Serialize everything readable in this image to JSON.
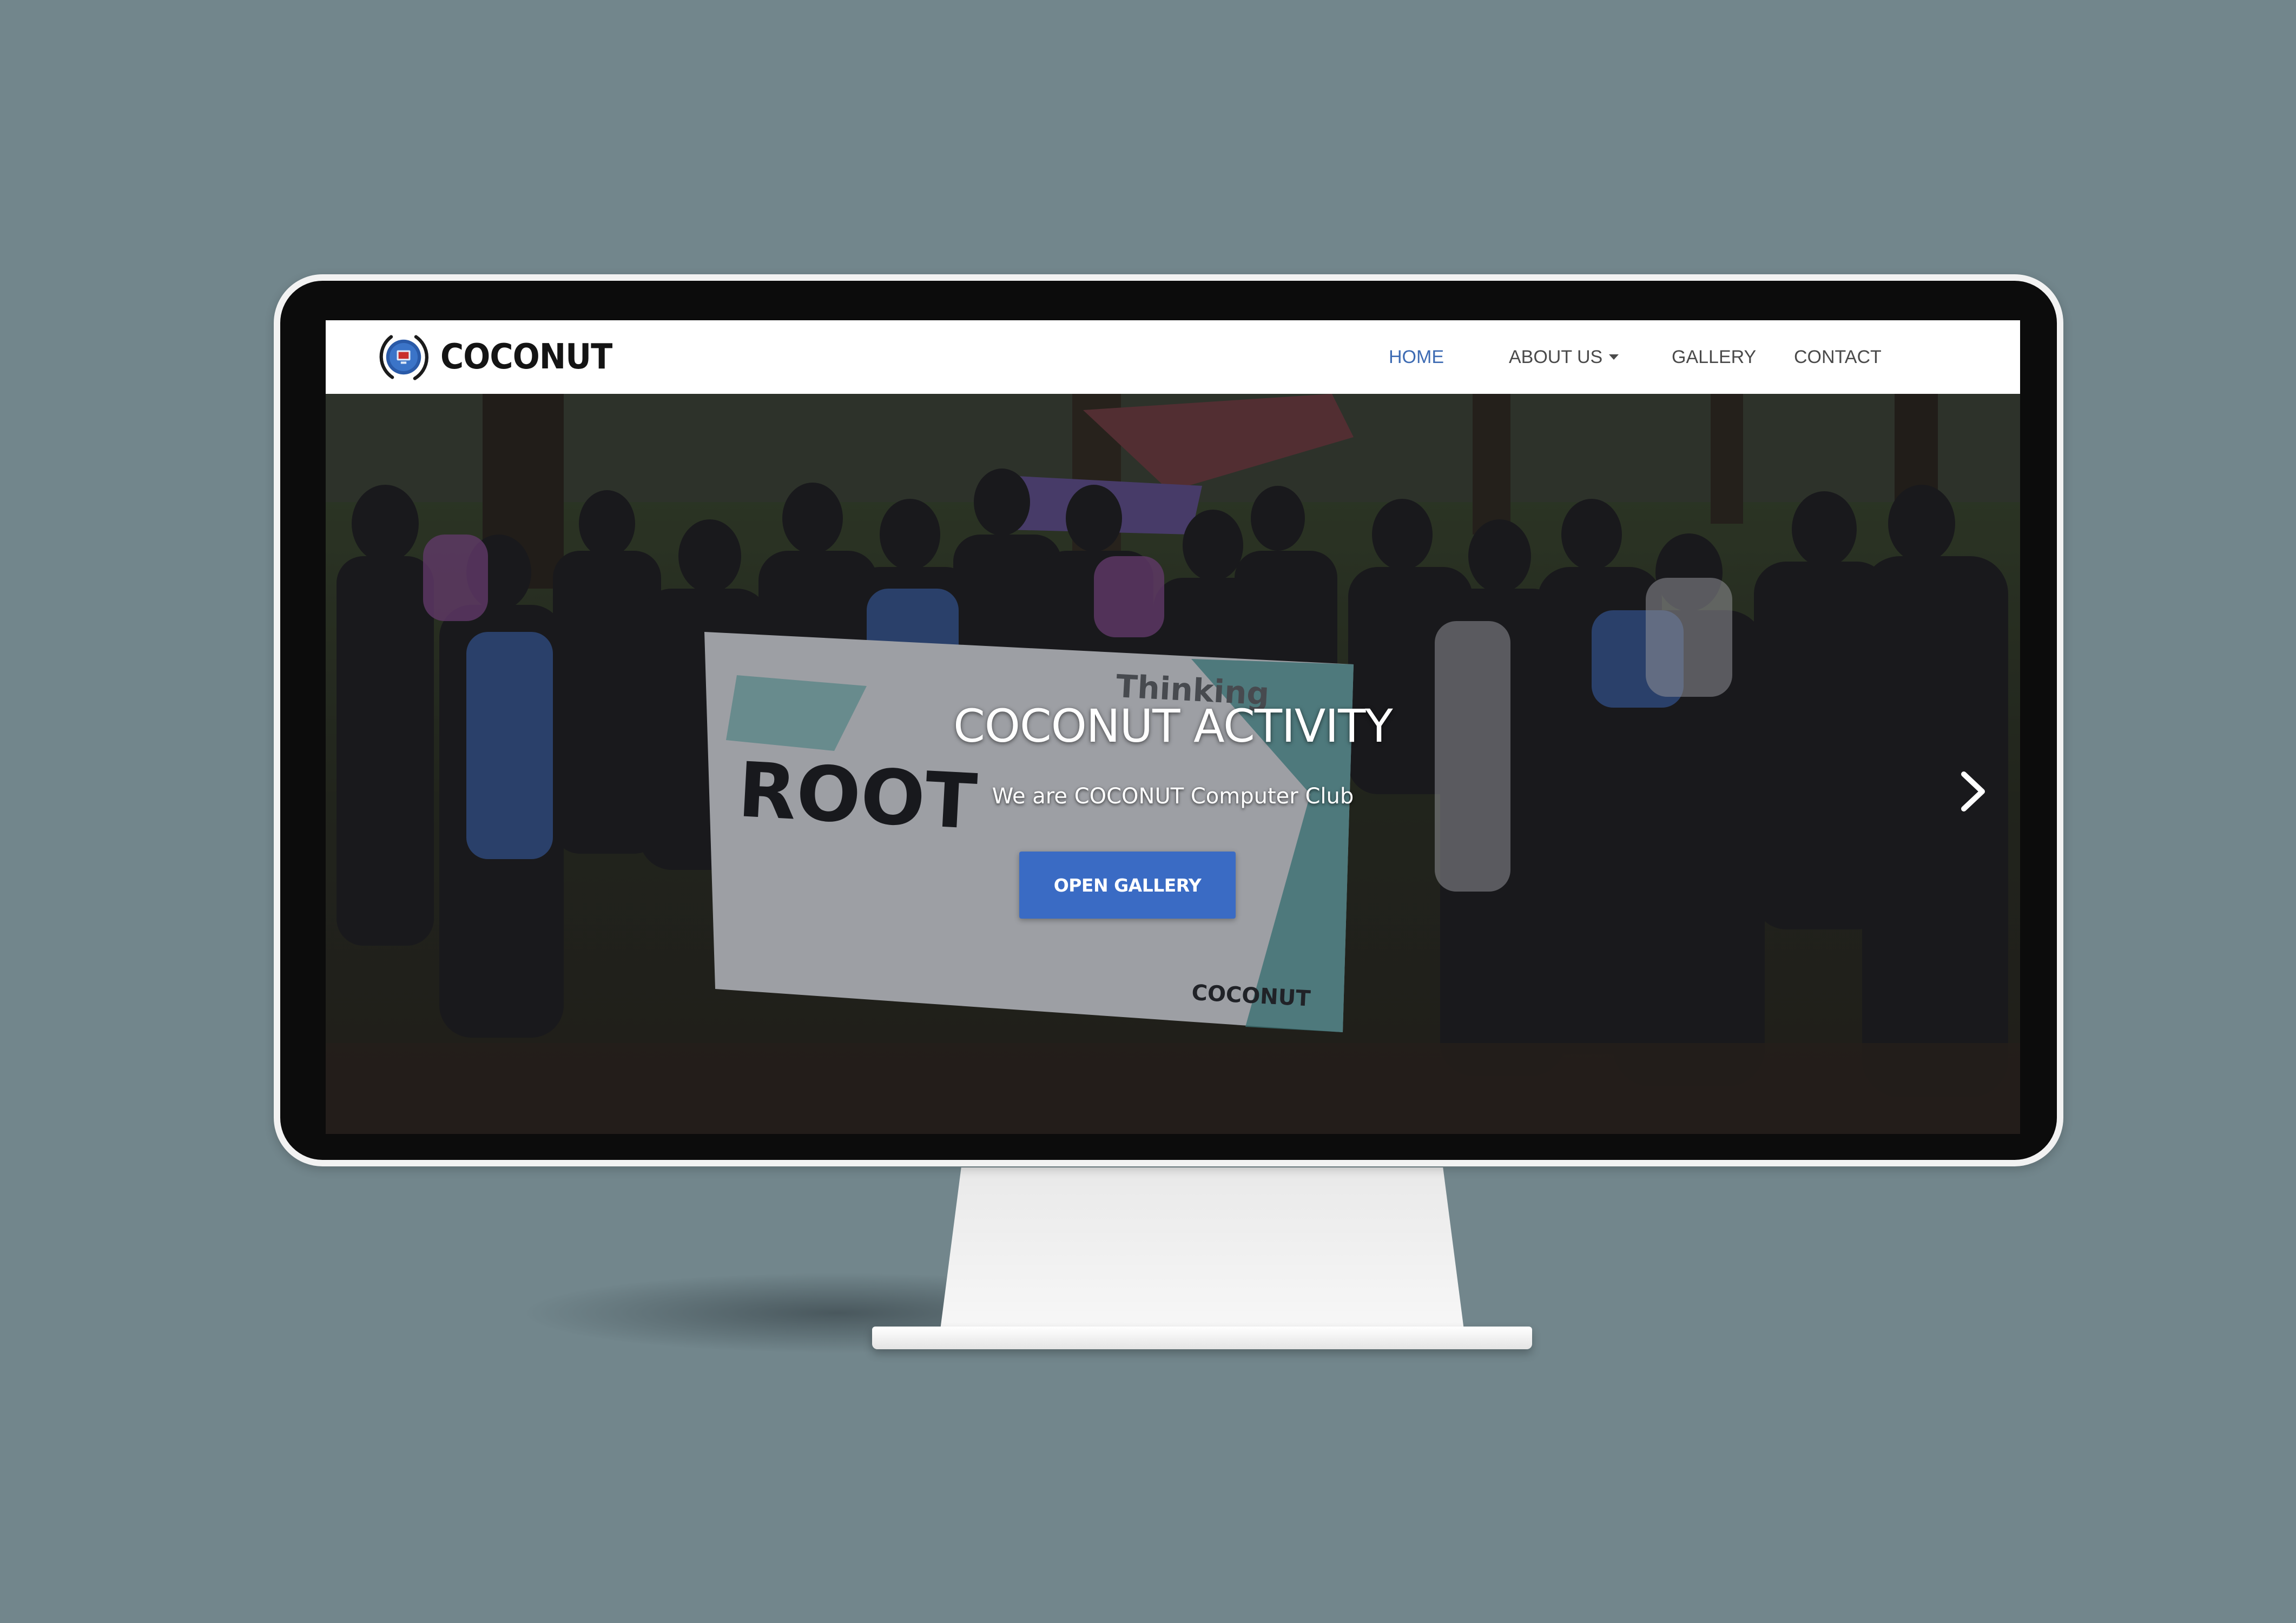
{
  "brand": {
    "name": "COCONUT",
    "logo_icon": "coconut-logo-icon"
  },
  "nav": {
    "items": [
      {
        "label": "HOME",
        "active": true
      },
      {
        "label": "ABOUT US",
        "has_dropdown": true
      },
      {
        "label": "GALLERY"
      },
      {
        "label": "CONTACT"
      }
    ]
  },
  "hero": {
    "title": "COCONUT ACTIVITY",
    "subtitle": "We are COCONUT Computer Club",
    "button_label": "OPEN GALLERY",
    "next_icon": "chevron-right-icon"
  },
  "colors": {
    "accent": "#3a6bc4",
    "active_nav": "#3d6bb3",
    "background": "#72868c"
  }
}
